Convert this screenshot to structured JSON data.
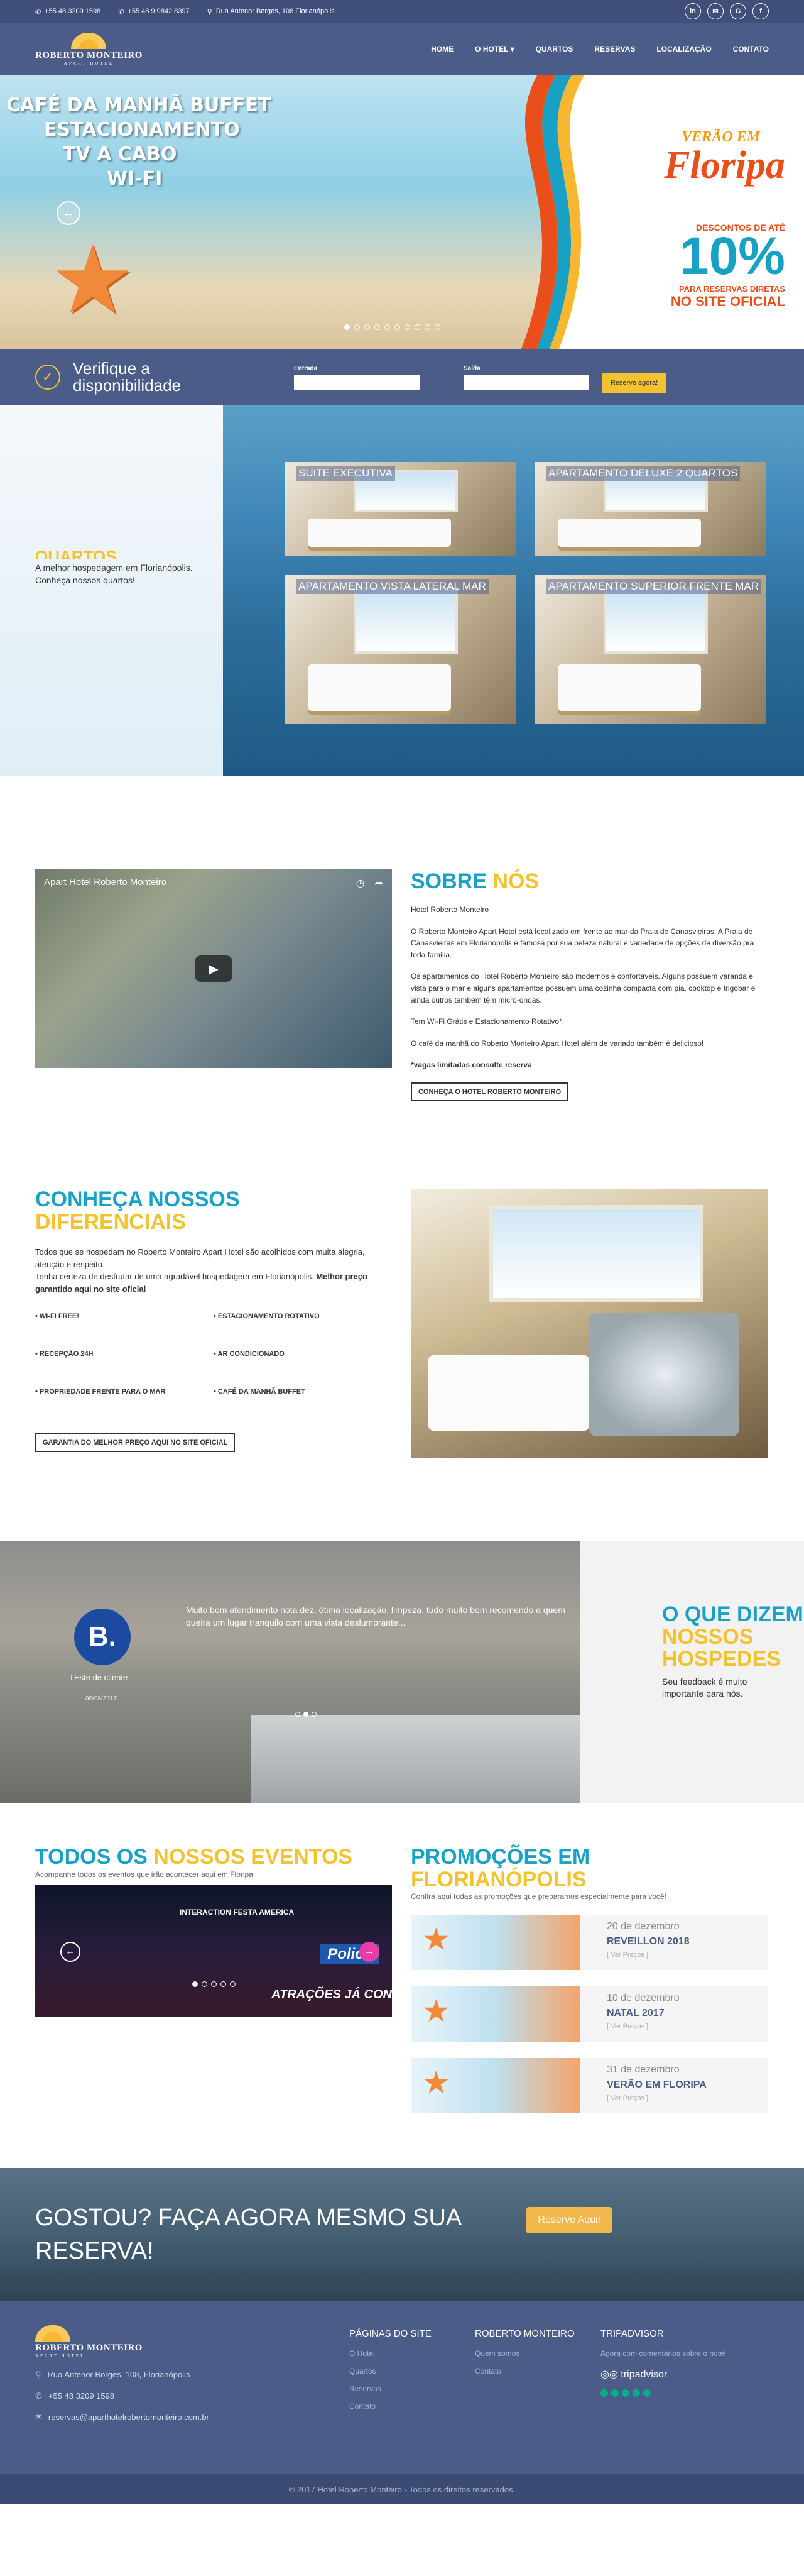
{
  "topbar": {
    "phone1": "+55 48 3209 1598",
    "phone2": "+55 48 9 9842 8397",
    "address": "Rua Antenor Borges, 108 Florianópolis",
    "socials": [
      "in",
      "✉",
      "G",
      "f"
    ]
  },
  "brand": {
    "name": "ROBERTO MONTEIRO",
    "tagline": "APART HOTEL"
  },
  "nav": {
    "items": [
      "HOME",
      "O HOTEL ▾",
      "QUARTOS",
      "RESERVAS",
      "LOCALIZAÇÃO",
      "CONTATO"
    ]
  },
  "hero": {
    "features": [
      "CAFÉ DA MANHÃ BUFFET",
      "ESTACIONAMENTO",
      "TV A CABO",
      "WI-FI"
    ],
    "promo_line1": "VERÃO EM",
    "promo_line2": "Floripa",
    "discount_label": "DESCONTOS DE ATÉ",
    "discount_value": "10%",
    "discount_note": "PARA RESERVAS DIRETAS",
    "discount_site": "NO SITE OFICIAL",
    "prev_icon": "←",
    "next_icon": "→",
    "slide_count": 10,
    "active_slide": 1
  },
  "availability": {
    "title": "Verifique a disponibilidade",
    "checkin_label": "Entrada",
    "checkout_label": "Saída",
    "button": "Reserve agora!"
  },
  "rooms": {
    "heading": "QUARTOS",
    "text": "A melhor hospedagem em Florianópolis. Conheça nossos quartos!",
    "items": [
      "SUITE EXECUTIVA",
      "APARTAMENTO DELUXE 2 QUARTOS",
      "APARTAMENTO VISTA LATERAL MAR",
      "APARTAMENTO SUPERIOR FRENTE MAR"
    ]
  },
  "about": {
    "video_title": "Apart Hotel Roberto Monteiro",
    "title_a": "SOBRE ",
    "title_b": "NÓS",
    "paragraphs": [
      "Hotel Roberto Monteiro",
      "O Roberto Monteiro Apart Hotel está localizado em frente ao mar da Praia de Canasvieiras. A Praia de Canasvieiras em Florianópolis é famosa por sua beleza natural e variedade de opções de diversão pra toda família.",
      "Os apartamentos do Hotel Roberto Monteiro são modernos e confortáveis. Alguns possuem varanda e vista para o mar e alguns apartamentos possuem uma cozinha compacta com pia, cooktop e frigobar e ainda outros também têm micro-ondas.",
      "Tem Wi-Fi Grátis e Estacionamento Rotativo*.",
      "O café da manhã do Roberto Monteiro Apart Hotel além de variado também é delicioso!"
    ],
    "note": "*vagas limitadas consulte reserva",
    "button": "CONHEÇA O HOTEL ROBERTO MONTEIRO"
  },
  "diferenciais": {
    "title_a": "CONHEÇA NOSSOS",
    "title_b": "DIFERENCIAIS",
    "text1": "Todos que se hospedam no Roberto Monteiro Apart Hotel são acolhidos com muita alegria, atenção e respeito.",
    "text2": "Tenha certeza de desfrutar de uma agradável hospedagem em Florianópolis. ",
    "text_bold": "Melhor preço garantido aqui no site oficial",
    "features": [
      "WI-FI FREE!",
      "ESTACIONAMENTO ROTATIVO",
      "RECEPÇÃO 24H",
      "AR CONDICIONADO",
      "PROPRIEDADE FRENTE PARA O MAR",
      "CAFÉ DA MANHÃ BUFFET"
    ],
    "button": "GARANTIA DO MELHOR PREÇO AQUI NO SITE OFICIAL"
  },
  "testimonials": {
    "avatar_letter": "B.",
    "quote": "Muito bom atendimento nota dez, ótima localização, limpeza, tudo muito bom recomendo a quem queira um lugar tranquilo com uma vista deslumbrante...",
    "author": "TEste de cliente",
    "date": "06/06/2017",
    "title_a": "O QUE DIZEM",
    "title_b": "NOSSOS HOSPEDES",
    "subtitle": "Seu feedback é muito importante para nós."
  },
  "events": {
    "title_a": "TODOS OS ",
    "title_b": "NOSSOS EVENTOS",
    "lead": "Acompanhe todos os eventos que irão acontecer aqui em Floripa!",
    "slide_brand": "INTERACTION FESTA AMERICA",
    "slide_tag": "Police",
    "slide_caption": "ATRAÇÕES JÁ CON",
    "dot_count": 5
  },
  "promotions": {
    "title_a": "PROMOÇÕES EM",
    "title_b": "FLORIANÓPOLIS",
    "lead": "Confira aqui todas as promoções que preparamos especialmente para você!",
    "items": [
      {
        "date": "20 de dezembro",
        "name": "REVEILLON 2018",
        "link": "[ Ver Preços ]"
      },
      {
        "date": "10 de dezembro",
        "name": "NATAL 2017",
        "link": "[ Ver Preços ]"
      },
      {
        "date": "31 de dezembro",
        "name": "VERÃO EM FLORIPA",
        "link": "[ Ver Preços ]"
      }
    ]
  },
  "cta": {
    "text": "GOSTOU? FAÇA AGORA MESMO SUA RESERVA!",
    "button": "Reserve Aqui!"
  },
  "footer": {
    "address": "Rua Antenor Borges, 108, Florianópolis",
    "phone": "+55 48 3209 1598",
    "email": "reservas@aparthotelrobertomonteiro.com.br",
    "col1_title": "PÁGINAS DO SITE",
    "col1_links": [
      "O Hotel",
      "Quartos",
      "Reservas",
      "Contato"
    ],
    "col2_title": "ROBERTO MONTEIRO",
    "col2_links": [
      "Quem somos",
      "Contato"
    ],
    "col3_title": "TRIPADVISOR",
    "col3_text": "Agora com comentários sobre o hotel",
    "trip_brand": "tripadvisor",
    "copyright": "© 2017 Hotel Roberto Monteiro - Todos os direitos reservados."
  }
}
